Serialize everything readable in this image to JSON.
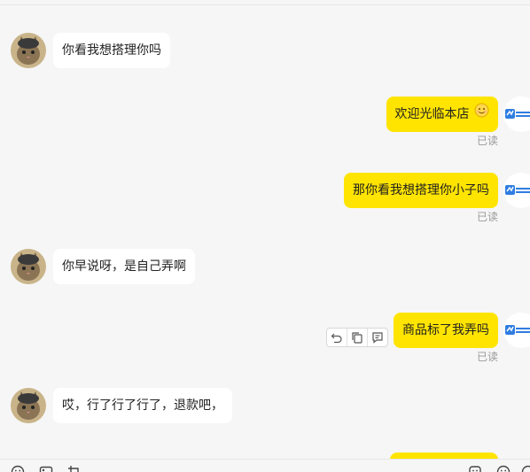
{
  "messages": [
    {
      "direction": "in",
      "text": "你看我想搭理你吗"
    },
    {
      "direction": "out",
      "text": "欢迎光临本店",
      "emoji": "smile-emoji",
      "status": "已读"
    },
    {
      "direction": "out",
      "text": "那你看我想搭理你小子吗",
      "status": "已读"
    },
    {
      "direction": "in",
      "text": "你早说呀，是自己弄啊"
    },
    {
      "direction": "out",
      "text": "商品标了我弄吗",
      "status": "已读"
    },
    {
      "direction": "in",
      "text": "哎，行了行了行了，退款吧，"
    }
  ],
  "message_actions": {
    "icons": [
      "undo-icon",
      "copy-icon",
      "quote-icon"
    ]
  },
  "toolbar": {
    "left_icons": [
      "emoji-icon",
      "image-icon",
      "crop-icon"
    ],
    "right_icons": [
      "shortcut-icon",
      "smile-icon",
      "more-icon"
    ]
  },
  "colors": {
    "outgoing_bubble": "#ffe400",
    "incoming_bubble": "#ffffff",
    "background": "#f6f6f6",
    "read_status": "#999999"
  }
}
